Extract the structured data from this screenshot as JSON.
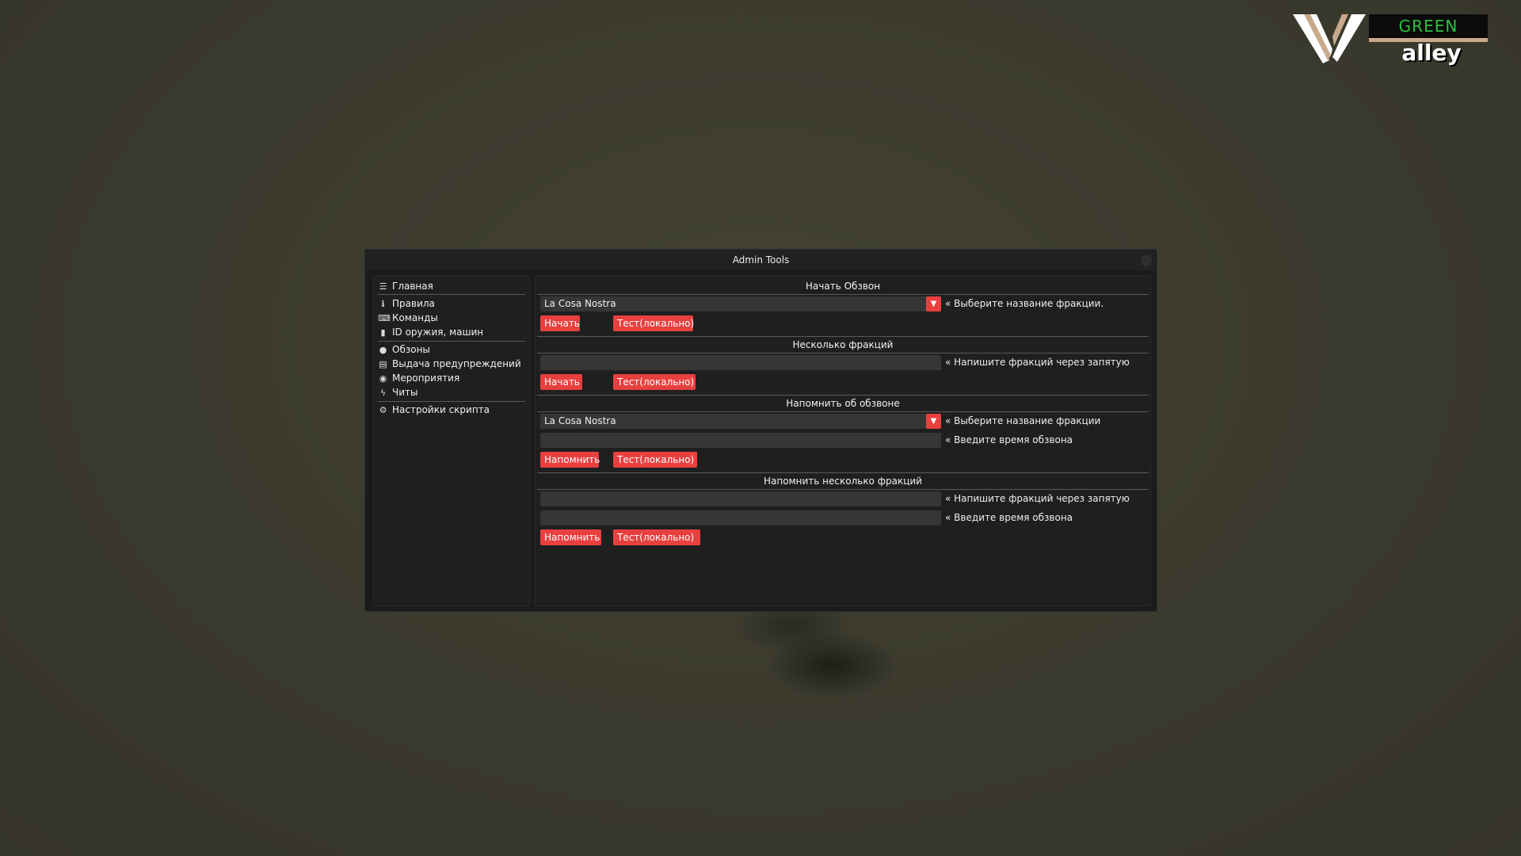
{
  "logo": {
    "top_word": "GREEN",
    "bottom_word": "alley",
    "letter": "V"
  },
  "window": {
    "title": "Admin Tools"
  },
  "sidebar": {
    "items": [
      {
        "icon": "menu-icon",
        "label": "Главная"
      },
      {
        "icon": "info-icon",
        "label": "Правила"
      },
      {
        "icon": "keyboard-icon",
        "label": "Команды"
      },
      {
        "icon": "book-icon",
        "label": "ID оружия, машин"
      },
      {
        "icon": "chat-icon",
        "label": "Обзоны"
      },
      {
        "icon": "document-icon",
        "label": "Выдача предупреждений"
      },
      {
        "icon": "gamepad-icon",
        "label": "Мероприятия"
      },
      {
        "icon": "bolt-icon",
        "label": "Читы"
      },
      {
        "icon": "gears-icon",
        "label": "Настройки скрипта"
      }
    ]
  },
  "sections": {
    "start": {
      "title": "Начать Обзвон",
      "select_value": "La Cosa Nostra",
      "hint": "« Выберите название фракции.",
      "btn_start": "Начать",
      "btn_test": "Тест(локально)"
    },
    "multi": {
      "title": "Несколько фракций",
      "input_value": "",
      "hint": "« Напишите фракций через запятую",
      "btn_start": "Начать",
      "btn_test": "Тест(локально)"
    },
    "remind": {
      "title": "Напомнить об обзвоне",
      "select_value": "La Cosa Nostra",
      "hint_select": "« Выберите название фракции",
      "time_value": "",
      "hint_time": "« Введите время обзвона",
      "btn_remind": "Напомнить",
      "btn_test": "Тест(локально)"
    },
    "remind_multi": {
      "title": "Напомнить несколько фракций",
      "input_value": "",
      "hint_input": "« Напишите фракций через запятую",
      "time_value": "",
      "hint_time": "« Введите время обзвона",
      "btn_remind": "Напомнить",
      "btn_test": "Тест(локально)"
    }
  },
  "colors": {
    "accent": "#e8403f",
    "window_bg": "#1b1b1b",
    "field_bg": "#363636",
    "logo_green": "#2fc23d"
  }
}
